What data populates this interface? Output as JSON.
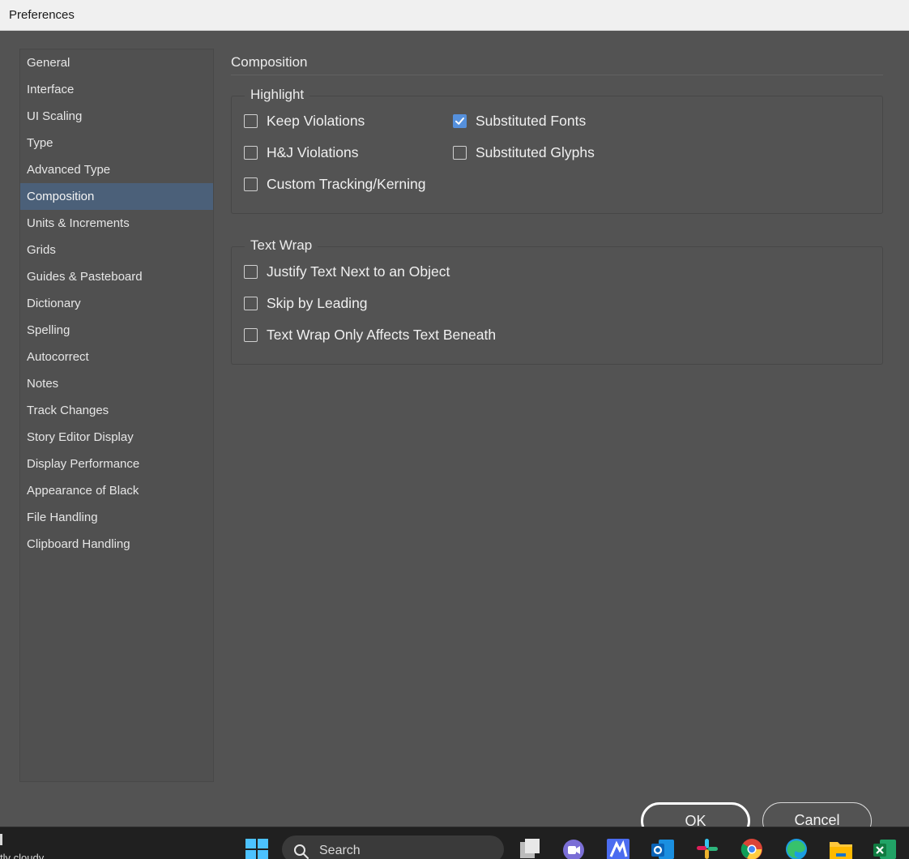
{
  "window": {
    "title": "Preferences"
  },
  "sidebar": {
    "selected": "Composition",
    "items": [
      "General",
      "Interface",
      "UI Scaling",
      "Type",
      "Advanced Type",
      "Composition",
      "Units & Increments",
      "Grids",
      "Guides & Pasteboard",
      "Dictionary",
      "Spelling",
      "Autocorrect",
      "Notes",
      "Track Changes",
      "Story Editor Display",
      "Display Performance",
      "Appearance of Black",
      "File Handling",
      "Clipboard Handling"
    ]
  },
  "main": {
    "section_title": "Composition",
    "highlight": {
      "legend": "Highlight",
      "options": [
        {
          "label": "Keep Violations",
          "checked": false
        },
        {
          "label": "H&J Violations",
          "checked": false
        },
        {
          "label": "Custom Tracking/Kerning",
          "checked": false
        },
        {
          "label": "Substituted Fonts",
          "checked": true
        },
        {
          "label": "Substituted Glyphs",
          "checked": false
        }
      ]
    },
    "text_wrap": {
      "legend": "Text Wrap",
      "options": [
        {
          "label": "Justify Text Next to an Object",
          "checked": false
        },
        {
          "label": "Skip by Leading",
          "checked": false
        },
        {
          "label": "Text Wrap Only Affects Text Beneath",
          "checked": false
        }
      ]
    }
  },
  "buttons": {
    "ok": "OK",
    "cancel": "Cancel"
  },
  "taskbar": {
    "weather": "tly cloudy",
    "search_label": "Search",
    "icons": [
      "windows-start-icon",
      "task-view-icon",
      "teams-icon",
      "maya-icon",
      "outlook-icon",
      "slack-icon",
      "chrome-icon",
      "edge-icon",
      "file-explorer-icon",
      "excel-icon"
    ]
  },
  "colors": {
    "accent": "#5590dc",
    "selection": "#4b6079",
    "panel": "#535353"
  }
}
